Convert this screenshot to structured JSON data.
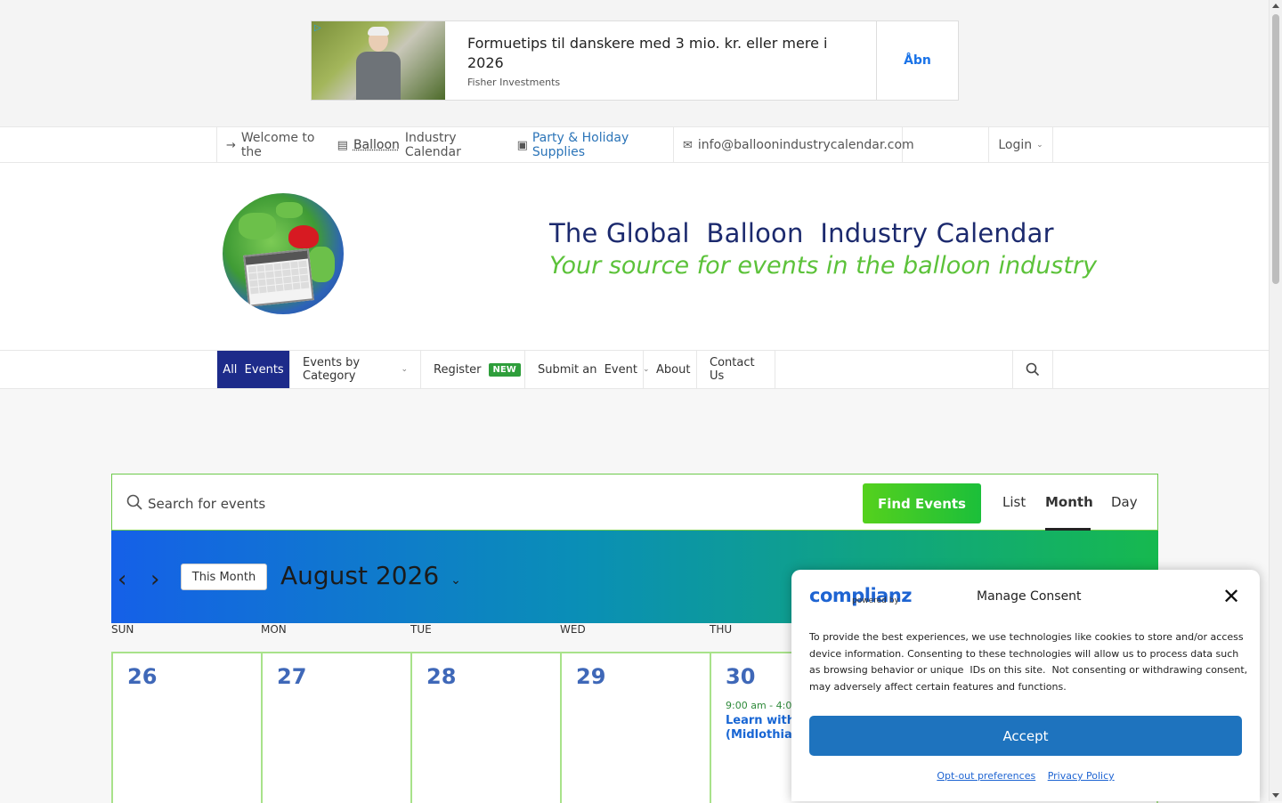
{
  "ad": {
    "headline": "Formuetips til danskere med 3 mio. kr. eller mere i 2026",
    "sponsor": "Fisher Investments",
    "cta": "Åbn"
  },
  "topbar": {
    "welcome_prefix": "Welcome to the",
    "welcome_word1": "Balloon",
    "welcome_word2": "Industry Calendar",
    "party_link": "Party &  Holiday Supplies",
    "email": "info@balloonindustrycalendar.com",
    "login": "Login"
  },
  "header": {
    "title": "The Global  Balloon  Industry Calendar",
    "tagline": "Your source for events in the balloon industry"
  },
  "nav": {
    "items": [
      {
        "label": "All  Events"
      },
      {
        "label": "Events by Category"
      },
      {
        "label": "Register"
      },
      {
        "label": "Submit an  Event"
      },
      {
        "label": "About"
      },
      {
        "label": "Contact Us"
      }
    ],
    "badge": "NEW"
  },
  "search": {
    "placeholder": "Search for events",
    "find_button": "Find Events",
    "views": [
      "List",
      "Month",
      "Day"
    ]
  },
  "calendar": {
    "this_month": "This Month",
    "month_label": "August 2026",
    "weekdays": [
      "SUN",
      "MON",
      "TUE",
      "WED",
      "THU"
    ],
    "days": [
      "26",
      "27",
      "28",
      "29",
      "30"
    ],
    "event_time": "9:00 am - 4:0",
    "event_title_line1": "Learn with",
    "event_title_line2": "(Midlothian"
  },
  "consent": {
    "brand": "complianz",
    "powered": "powered by",
    "title": "Manage Consent",
    "body": "To provide the best experiences, we use technologies like cookies to store and/or access device information. Consenting to these technologies will allow us to process data such as browsing behavior or unique  IDs on this site.  Not consenting or withdrawing consent, may adversely affect certain features and functions.",
    "accept": "Accept",
    "opt_out": "Opt-out preferences",
    "privacy": "Privacy Policy"
  }
}
